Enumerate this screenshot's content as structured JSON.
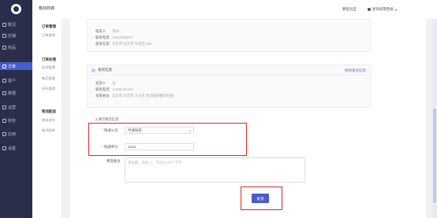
{
  "app": {
    "title": "移动商城"
  },
  "header": {
    "help": "教程社区",
    "user": "浙商城零售批"
  },
  "nav": {
    "items": [
      {
        "label": "概况",
        "icon": "home-icon"
      },
      {
        "label": "店铺",
        "icon": "shop-icon"
      },
      {
        "label": "商品",
        "icon": "goods-icon"
      },
      {
        "label": "订单",
        "icon": "order-icon",
        "active": true
      },
      {
        "label": "客户",
        "icon": "customer-icon"
      },
      {
        "label": "数据",
        "icon": "data-icon"
      },
      {
        "label": "运营",
        "icon": "operation-icon"
      },
      {
        "label": "财务",
        "icon": "finance-icon"
      },
      {
        "label": "应用",
        "icon": "app-icon"
      },
      {
        "label": "设置",
        "icon": "settings-icon"
      }
    ]
  },
  "submenu": {
    "groups": [
      {
        "title": "订单管理",
        "items": [
          "订单查询"
        ]
      },
      {
        "title": "订单处理",
        "items": [
          "发货管理",
          "售后管理",
          "评价管理"
        ]
      },
      {
        "title": "物流配送",
        "items": [
          "物流发货",
          "电子面单"
        ]
      }
    ]
  },
  "receiver": {
    "name_label": "收货人",
    "name": "测试",
    "phone_label": "联系电话",
    "phone": "15011008007",
    "addr_label": "收货信息",
    "addr": "北京市 北京市 东城区 dd4"
  },
  "sender": {
    "title": "发货信息",
    "edit": "修改发货信息",
    "name_label": "发货人",
    "name": "张",
    "phone_label": "联系电话",
    "phone": "12456452453",
    "addr_label": "发货地址",
    "addr": "北京市 北京市 大兴区 物流园路数码社路"
  },
  "logistics": {
    "section": "2.填写物流信息",
    "company_label": "快递公司",
    "company_value": "申通快递",
    "number_label": "快递单号",
    "number_value": "11111",
    "remark_label": "物流备注",
    "remark_placeholder": "请设置，例如入，不超过100个字符"
  },
  "actions": {
    "submit": "发货"
  },
  "colors": {
    "accent": "#4a5cc9",
    "highlight": "#e0252a",
    "nav_bg": "#2b2e4a"
  }
}
